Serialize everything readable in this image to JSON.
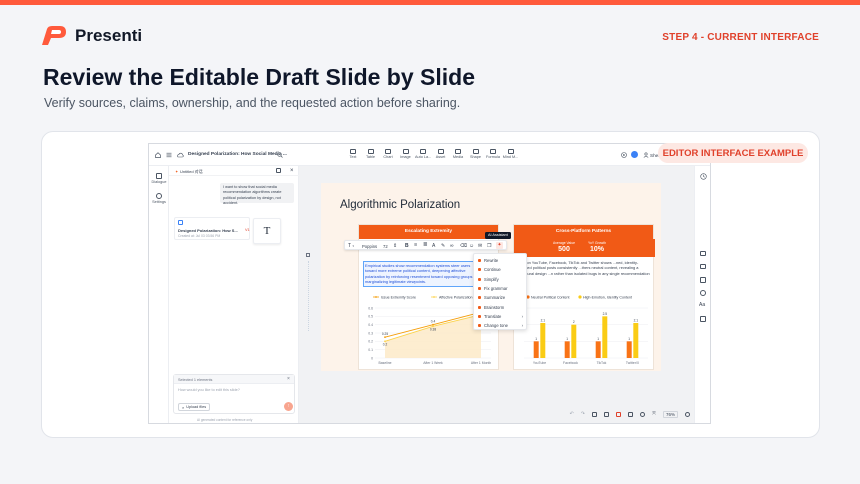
{
  "brand": {
    "name": "Presenti",
    "accent": "#ff5a3c"
  },
  "header": {
    "step": "STEP 4 - CURRENT INTERFACE",
    "title": "Review the Editable Draft Slide by Slide",
    "subtitle": "Verify sources, claims, ownership, and the requested action before sharing."
  },
  "badge": "EDITOR INTERFACE EXAMPLE",
  "app": {
    "doc_title": "Designed Polarization: How Social Media ...",
    "user_name": "Shen",
    "toolbar": [
      {
        "label": "Text",
        "icon": "text-icon"
      },
      {
        "label": "Table",
        "icon": "table-icon"
      },
      {
        "label": "Chart",
        "icon": "chart-icon"
      },
      {
        "label": "Image",
        "icon": "image-icon"
      },
      {
        "label": "Auto La...",
        "icon": "layout-icon"
      },
      {
        "label": "Asset",
        "icon": "asset-icon"
      },
      {
        "label": "Media",
        "icon": "media-icon"
      },
      {
        "label": "Shape",
        "icon": "shape-icon"
      },
      {
        "label": "Formula",
        "icon": "formula-icon"
      },
      {
        "label": "Mind M...",
        "icon": "mindmap-icon"
      }
    ],
    "rail": [
      {
        "label": "Dialogue",
        "icon": "dialogue-icon"
      },
      {
        "label": "Settings",
        "icon": "settings-icon"
      }
    ],
    "chat": {
      "tab_title": "Untitled 对话",
      "message": "I want to show that social media recommendation algorithms create political polarization by design, not accident.",
      "file_title": "Designed Polarization: How S...",
      "file_tag": "V1",
      "file_meta": "Created at: Jul 03 03:56 PM",
      "selected_label": "Selected 1 elements",
      "input_placeholder": "How would you like to edit this slide?",
      "upload_label": "Upload files",
      "footer_note": "AI generated content for reference only"
    },
    "slide": {
      "title": "Algorithmic Polarization",
      "left_panel_title": "Escalating Extremity",
      "left_body": "Empirical studies show recommendation systems steer users toward more extreme political content, deepening affective polarization by reinforcing resentment toward opposing groups and marginalizing legitimate viewpoints.",
      "right_panel_title": "Cross-Platform Patterns",
      "metric_1_label": "Average Value",
      "metric_1_value": "500",
      "metric_2_label": "YoY Growth",
      "metric_2_value": "10%",
      "right_body": "...ch on YouTube, Facebook, TikTok and Twitter shows ...ned, identity-focused political posts consistently ...thers neutral content, revealing a structural design ...n rather than isolated bugs in any single recommendation ...m."
    },
    "font_name": "Poppins",
    "font_size": "72",
    "ai_tooltip": "AI Assistant",
    "ai_menu": [
      "Rewrite",
      "Continue",
      "Simplify",
      "Fix grammar",
      "Summarize",
      "Brainstorm",
      "Translate",
      "Change tone"
    ],
    "zoom": "76%"
  },
  "chart_data": [
    {
      "type": "line",
      "categories": [
        "Baseline",
        "After 1 Week",
        "After 1 Month"
      ],
      "series": [
        {
          "name": "Issue Extremity Score",
          "values": [
            0.25,
            0.4,
            0.55
          ],
          "color": "#f59e0b"
        },
        {
          "name": "Affective Polarization",
          "values": [
            0.2,
            0.38,
            0.52
          ],
          "color": "#fcd34d"
        }
      ],
      "data_labels": [
        [
          "0.25",
          "0.4",
          "0.55"
        ],
        [
          "0.2",
          "0.38",
          "0.52"
        ]
      ],
      "y_ticks": [
        "0",
        "0.1",
        "0.2",
        "0.3",
        "0.4",
        "0.5",
        "0.6"
      ],
      "ylim": [
        0,
        0.6
      ],
      "grid": true,
      "legend": "top"
    },
    {
      "type": "bar",
      "categories": [
        "YouTube",
        "Facebook",
        "TikTok",
        "Twitter/X"
      ],
      "series": [
        {
          "name": "Neutral Political Content",
          "values": [
            1,
            1,
            1,
            1
          ],
          "color": "#f97316"
        },
        {
          "name": "High-Emotion, Identity Content",
          "values": [
            2.1,
            2,
            2.5,
            2.1
          ],
          "color": "#facc15"
        }
      ],
      "data_labels": [
        [
          "1",
          "1",
          "1",
          "1"
        ],
        [
          "2.1",
          "2",
          "2.5",
          "2.1"
        ]
      ],
      "ylim": [
        0,
        3
      ],
      "grid": true,
      "legend": "top"
    }
  ]
}
